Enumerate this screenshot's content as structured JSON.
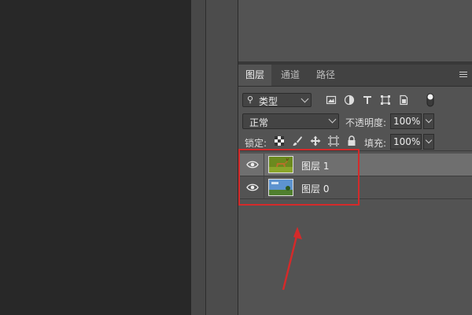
{
  "panel": {
    "tabs": [
      {
        "label": "图层",
        "active": true
      },
      {
        "label": "通道",
        "active": false
      },
      {
        "label": "路径",
        "active": false
      }
    ]
  },
  "filter": {
    "kind_label": "类型",
    "icons": [
      "image-filter-icon",
      "adjustment-filter-icon",
      "type-filter-icon",
      "shape-filter-icon",
      "smart-object-filter-icon",
      "filter-toggle-icon"
    ]
  },
  "blend": {
    "mode": "正常",
    "opacity_label": "不透明度:",
    "opacity_value": "100%"
  },
  "lock": {
    "label": "锁定:",
    "fill_label": "填充:",
    "fill_value": "100%"
  },
  "layers": [
    {
      "name": "图层 1",
      "selected": true,
      "visible": true
    },
    {
      "name": "图层 0",
      "selected": false,
      "visible": true
    }
  ],
  "colors": {
    "highlight": "#d42a2a",
    "canvas_bg": "#282828",
    "panel_bg": "#535353"
  }
}
